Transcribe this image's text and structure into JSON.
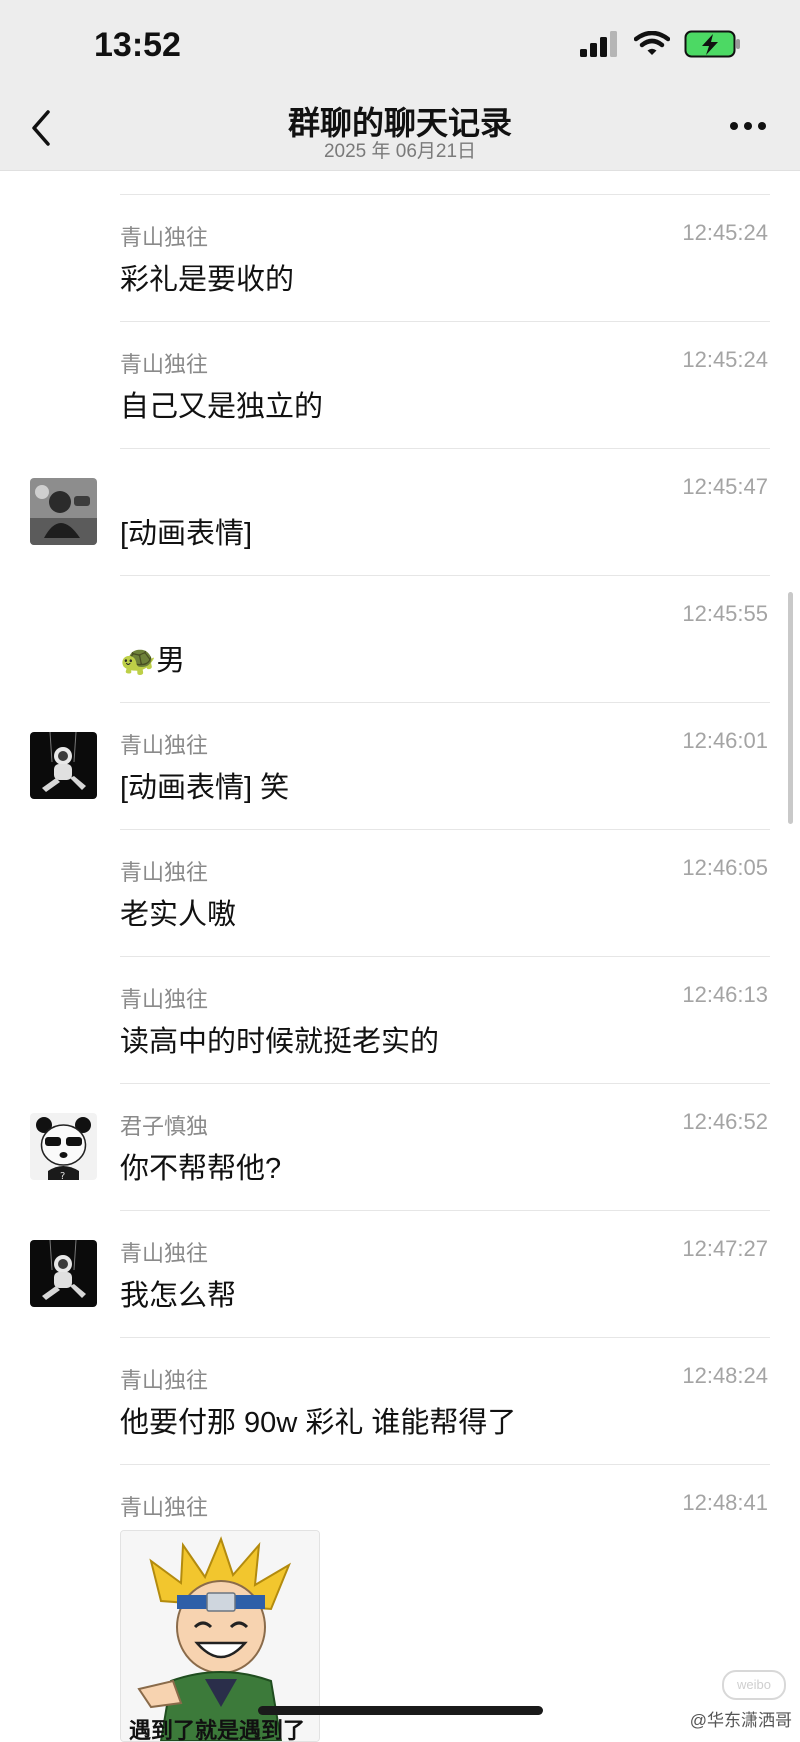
{
  "status_bar": {
    "time": "13:52"
  },
  "header": {
    "title": "群聊的聊天记录",
    "subtitle": "2025 年 06月21日"
  },
  "messages": [
    {
      "sender": "青山独往",
      "time": "12:45:24",
      "text": "彩礼是要收的",
      "avatar": "none"
    },
    {
      "sender": "青山独往",
      "time": "12:45:24",
      "text": "自己又是独立的",
      "avatar": "none"
    },
    {
      "sender": "",
      "time": "12:45:47",
      "text": "[动画表情]",
      "avatar": "photo-avatar"
    },
    {
      "sender": "",
      "time": "12:45:55",
      "text": "🐢男",
      "avatar": "none"
    },
    {
      "sender": "青山独往",
      "time": "12:46:01",
      "text": "[动画表情] 笑",
      "avatar": "astronaut-avatar"
    },
    {
      "sender": "青山独往",
      "time": "12:46:05",
      "text": "老实人嗷",
      "avatar": "none"
    },
    {
      "sender": "青山独往",
      "time": "12:46:13",
      "text": "读高中的时候就挺老实的",
      "avatar": "none"
    },
    {
      "sender": "君子慎独",
      "time": "12:46:52",
      "text": "你不帮帮他?",
      "avatar": "panda-avatar"
    },
    {
      "sender": "青山独往",
      "time": "12:47:27",
      "text": "我怎么帮",
      "avatar": "astronaut-avatar"
    },
    {
      "sender": "青山独往",
      "time": "12:48:24",
      "text": "他要付那 90w 彩礼 谁能帮得了",
      "avatar": "none"
    },
    {
      "sender": "青山独往",
      "time": "12:48:41",
      "text": "",
      "avatar": "none"
    }
  ],
  "sticker": {
    "caption": "遇到了就是遇到了",
    "icon": "cartoon-ninja-sticker"
  },
  "watermark": "@华东潇洒哥",
  "colors": {
    "header_bg": "#ededed",
    "battery_green": "#4cd964",
    "text_secondary": "#8a8a8a"
  }
}
